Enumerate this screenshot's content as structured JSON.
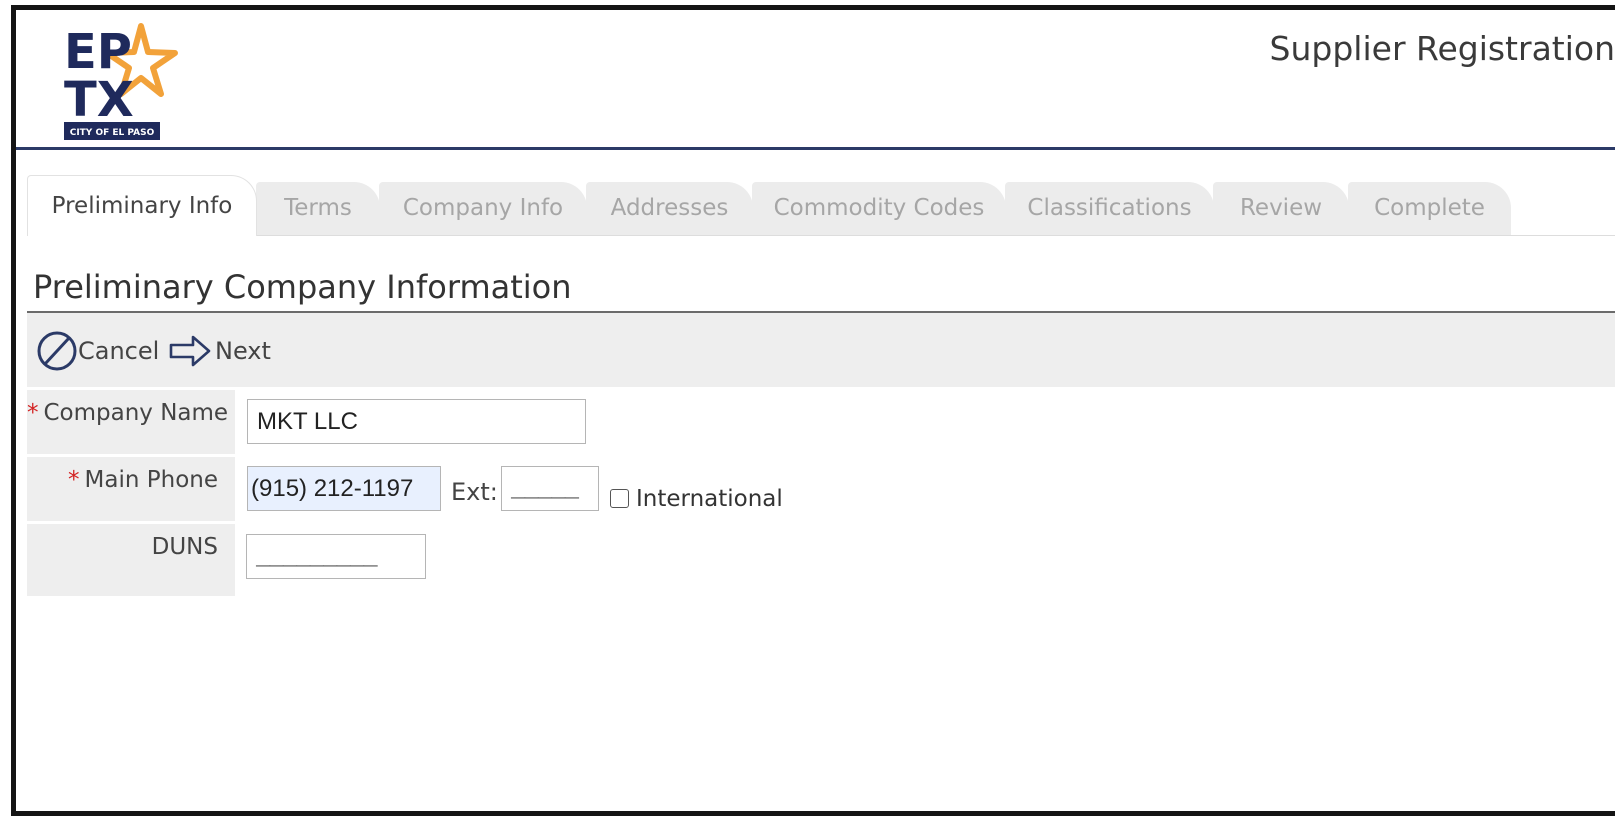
{
  "header": {
    "logo": {
      "line1": "EP",
      "line2": "TX",
      "caption": "CITY OF EL PASO"
    },
    "title": "Supplier Registration"
  },
  "tabs": [
    {
      "label": "Preliminary Info",
      "active": true
    },
    {
      "label": "Terms"
    },
    {
      "label": "Company Info"
    },
    {
      "label": "Addresses"
    },
    {
      "label": "Commodity Codes"
    },
    {
      "label": "Classifications"
    },
    {
      "label": "Review"
    },
    {
      "label": "Complete"
    }
  ],
  "section": {
    "title": "Preliminary Company Information"
  },
  "toolbar": {
    "cancel_label": "Cancel",
    "cancel_icon": "cancel-icon",
    "next_label": "Next",
    "next_icon": "arrow-right-icon"
  },
  "form": {
    "required_marker": "*",
    "company_name": {
      "label": "Company Name",
      "value": "MKT LLC"
    },
    "main_phone": {
      "label": "Main Phone",
      "value": "(915) 212-1197",
      "ext_label": "Ext:",
      "ext_mask": "_____",
      "international_label": "International",
      "international_checked": false
    },
    "duns": {
      "label": "DUNS",
      "mask": "_________"
    }
  },
  "colors": {
    "header_rule": "#2b3a67",
    "logo_navy": "#1f2a5c",
    "logo_star": "#f2a23a",
    "required": "#d32222",
    "toolbar_bg": "#eeeeee",
    "focused_field": "#e8f0fe"
  }
}
